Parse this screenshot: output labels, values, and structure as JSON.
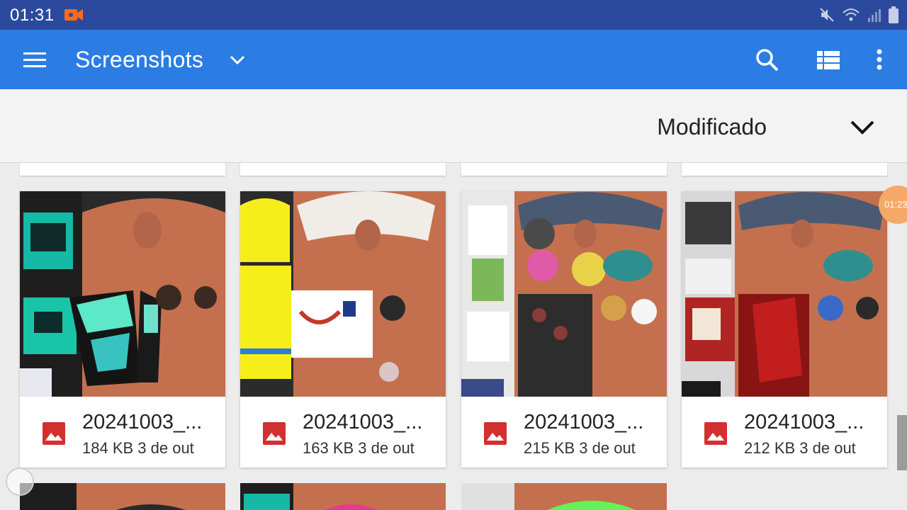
{
  "status_bar": {
    "time": "01:31"
  },
  "app_bar": {
    "title": "Screenshots"
  },
  "sort": {
    "label": "Modificado"
  },
  "files": [
    {
      "name": "20241003_...",
      "meta": "184 KB 3 de out"
    },
    {
      "name": "20241003_...",
      "meta": "163 KB 3 de out"
    },
    {
      "name": "20241003_...",
      "meta": "215 KB 3 de out"
    },
    {
      "name": "20241003_...",
      "meta": "212 KB 3 de out"
    }
  ],
  "floating_timer": "01:23",
  "colors": {
    "status_bar": "#2b4a9e",
    "app_bar": "#2b7de3",
    "image_icon": "#d32f2f",
    "skin_texture": "#c4704f"
  },
  "icons": {
    "menu": "hamburger-icon",
    "dropdown": "chevron-down-icon",
    "search": "search-icon",
    "view": "list-view-icon",
    "more": "more-vert-icon",
    "file": "image-icon"
  }
}
